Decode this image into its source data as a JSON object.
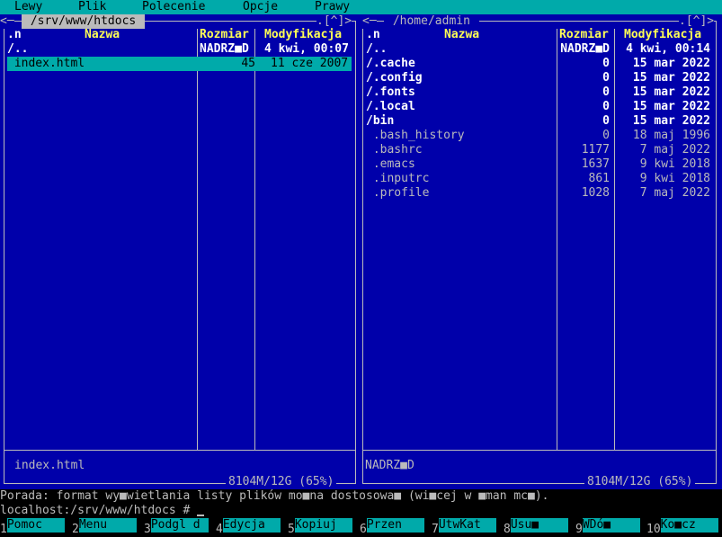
{
  "menubar": {
    "items": [
      "Lewy",
      "Plik",
      "Polecenie",
      "Opcje",
      "Prawy"
    ]
  },
  "left_panel": {
    "path": " /srv/www/htdocs ",
    "corner_left": "<─",
    "corner_right": ".[^]>",
    "sort_indicator": ".n",
    "col_name": "Nazwa",
    "col_size": "Rozmiar",
    "col_modified": "Modyfikacja",
    "rows": [
      {
        "name": "/..",
        "size": "NADRZ■D",
        "modified": "4 kwi, 00:07",
        "kind": "updir"
      },
      {
        "name": " index.html",
        "size": "45",
        "modified": "11 cze 2007",
        "kind": "cursor"
      }
    ],
    "status": "index.html",
    "free": "8104M/12G (65%)"
  },
  "right_panel": {
    "path": " /home/admin ",
    "corner_left": "<─",
    "corner_right": ".[^]>",
    "sort_indicator": ".n",
    "col_name": "Nazwa",
    "col_size": "Rozmiar",
    "col_modified": "Modyfikacja",
    "rows": [
      {
        "name": "/..",
        "size": "NADRZ■D",
        "modified": "4 kwi, 00:14",
        "kind": "updir"
      },
      {
        "name": "/.cache",
        "size": "0",
        "modified": "15 mar 2022",
        "kind": "dir"
      },
      {
        "name": "/.config",
        "size": "0",
        "modified": "15 mar 2022",
        "kind": "dir"
      },
      {
        "name": "/.fonts",
        "size": "0",
        "modified": "15 mar 2022",
        "kind": "dir"
      },
      {
        "name": "/.local",
        "size": "0",
        "modified": "15 mar 2022",
        "kind": "dir"
      },
      {
        "name": "/bin",
        "size": "0",
        "modified": "15 mar 2022",
        "kind": "dir"
      },
      {
        "name": " .bash_history",
        "size": "0",
        "modified": "18 maj 1996",
        "kind": "file"
      },
      {
        "name": " .bashrc",
        "size": "1177",
        "modified": "7 maj 2022",
        "kind": "file"
      },
      {
        "name": " .emacs",
        "size": "1637",
        "modified": "9 kwi 2018",
        "kind": "file"
      },
      {
        "name": " .inputrc",
        "size": "861",
        "modified": "9 kwi 2018",
        "kind": "file"
      },
      {
        "name": " .profile",
        "size": "1028",
        "modified": "7 maj 2022",
        "kind": "file"
      }
    ],
    "status": "NADRZ■D",
    "free": "8104M/12G (65%)"
  },
  "hint": "Porada: format wy■wietlania listy plików mo■na dostosowa■ (wi■cej w ■man mc■).",
  "command_line": {
    "prompt": "localhost:/srv/www/htdocs # "
  },
  "fkeys": [
    {
      "num": "1",
      "label": "Pomoc"
    },
    {
      "num": "2",
      "label": "Menu"
    },
    {
      "num": "3",
      "label": "Podgl d"
    },
    {
      "num": "4",
      "label": "Edycja"
    },
    {
      "num": "5",
      "label": "Kopiuj"
    },
    {
      "num": "6",
      "label": "Przen"
    },
    {
      "num": "7",
      "label": "UtwKat"
    },
    {
      "num": "8",
      "label": "Usu■"
    },
    {
      "num": "9",
      "label": "WDó■"
    },
    {
      "num": "10",
      "label": "Ko■cz"
    }
  ],
  "colors": {
    "panel_bg": "#0000aa",
    "menubar_bg": "#00aaaa",
    "header_fg": "#ffff55",
    "frame_fg": "#bbbbbb",
    "cursor_bg": "#00aaaa"
  }
}
